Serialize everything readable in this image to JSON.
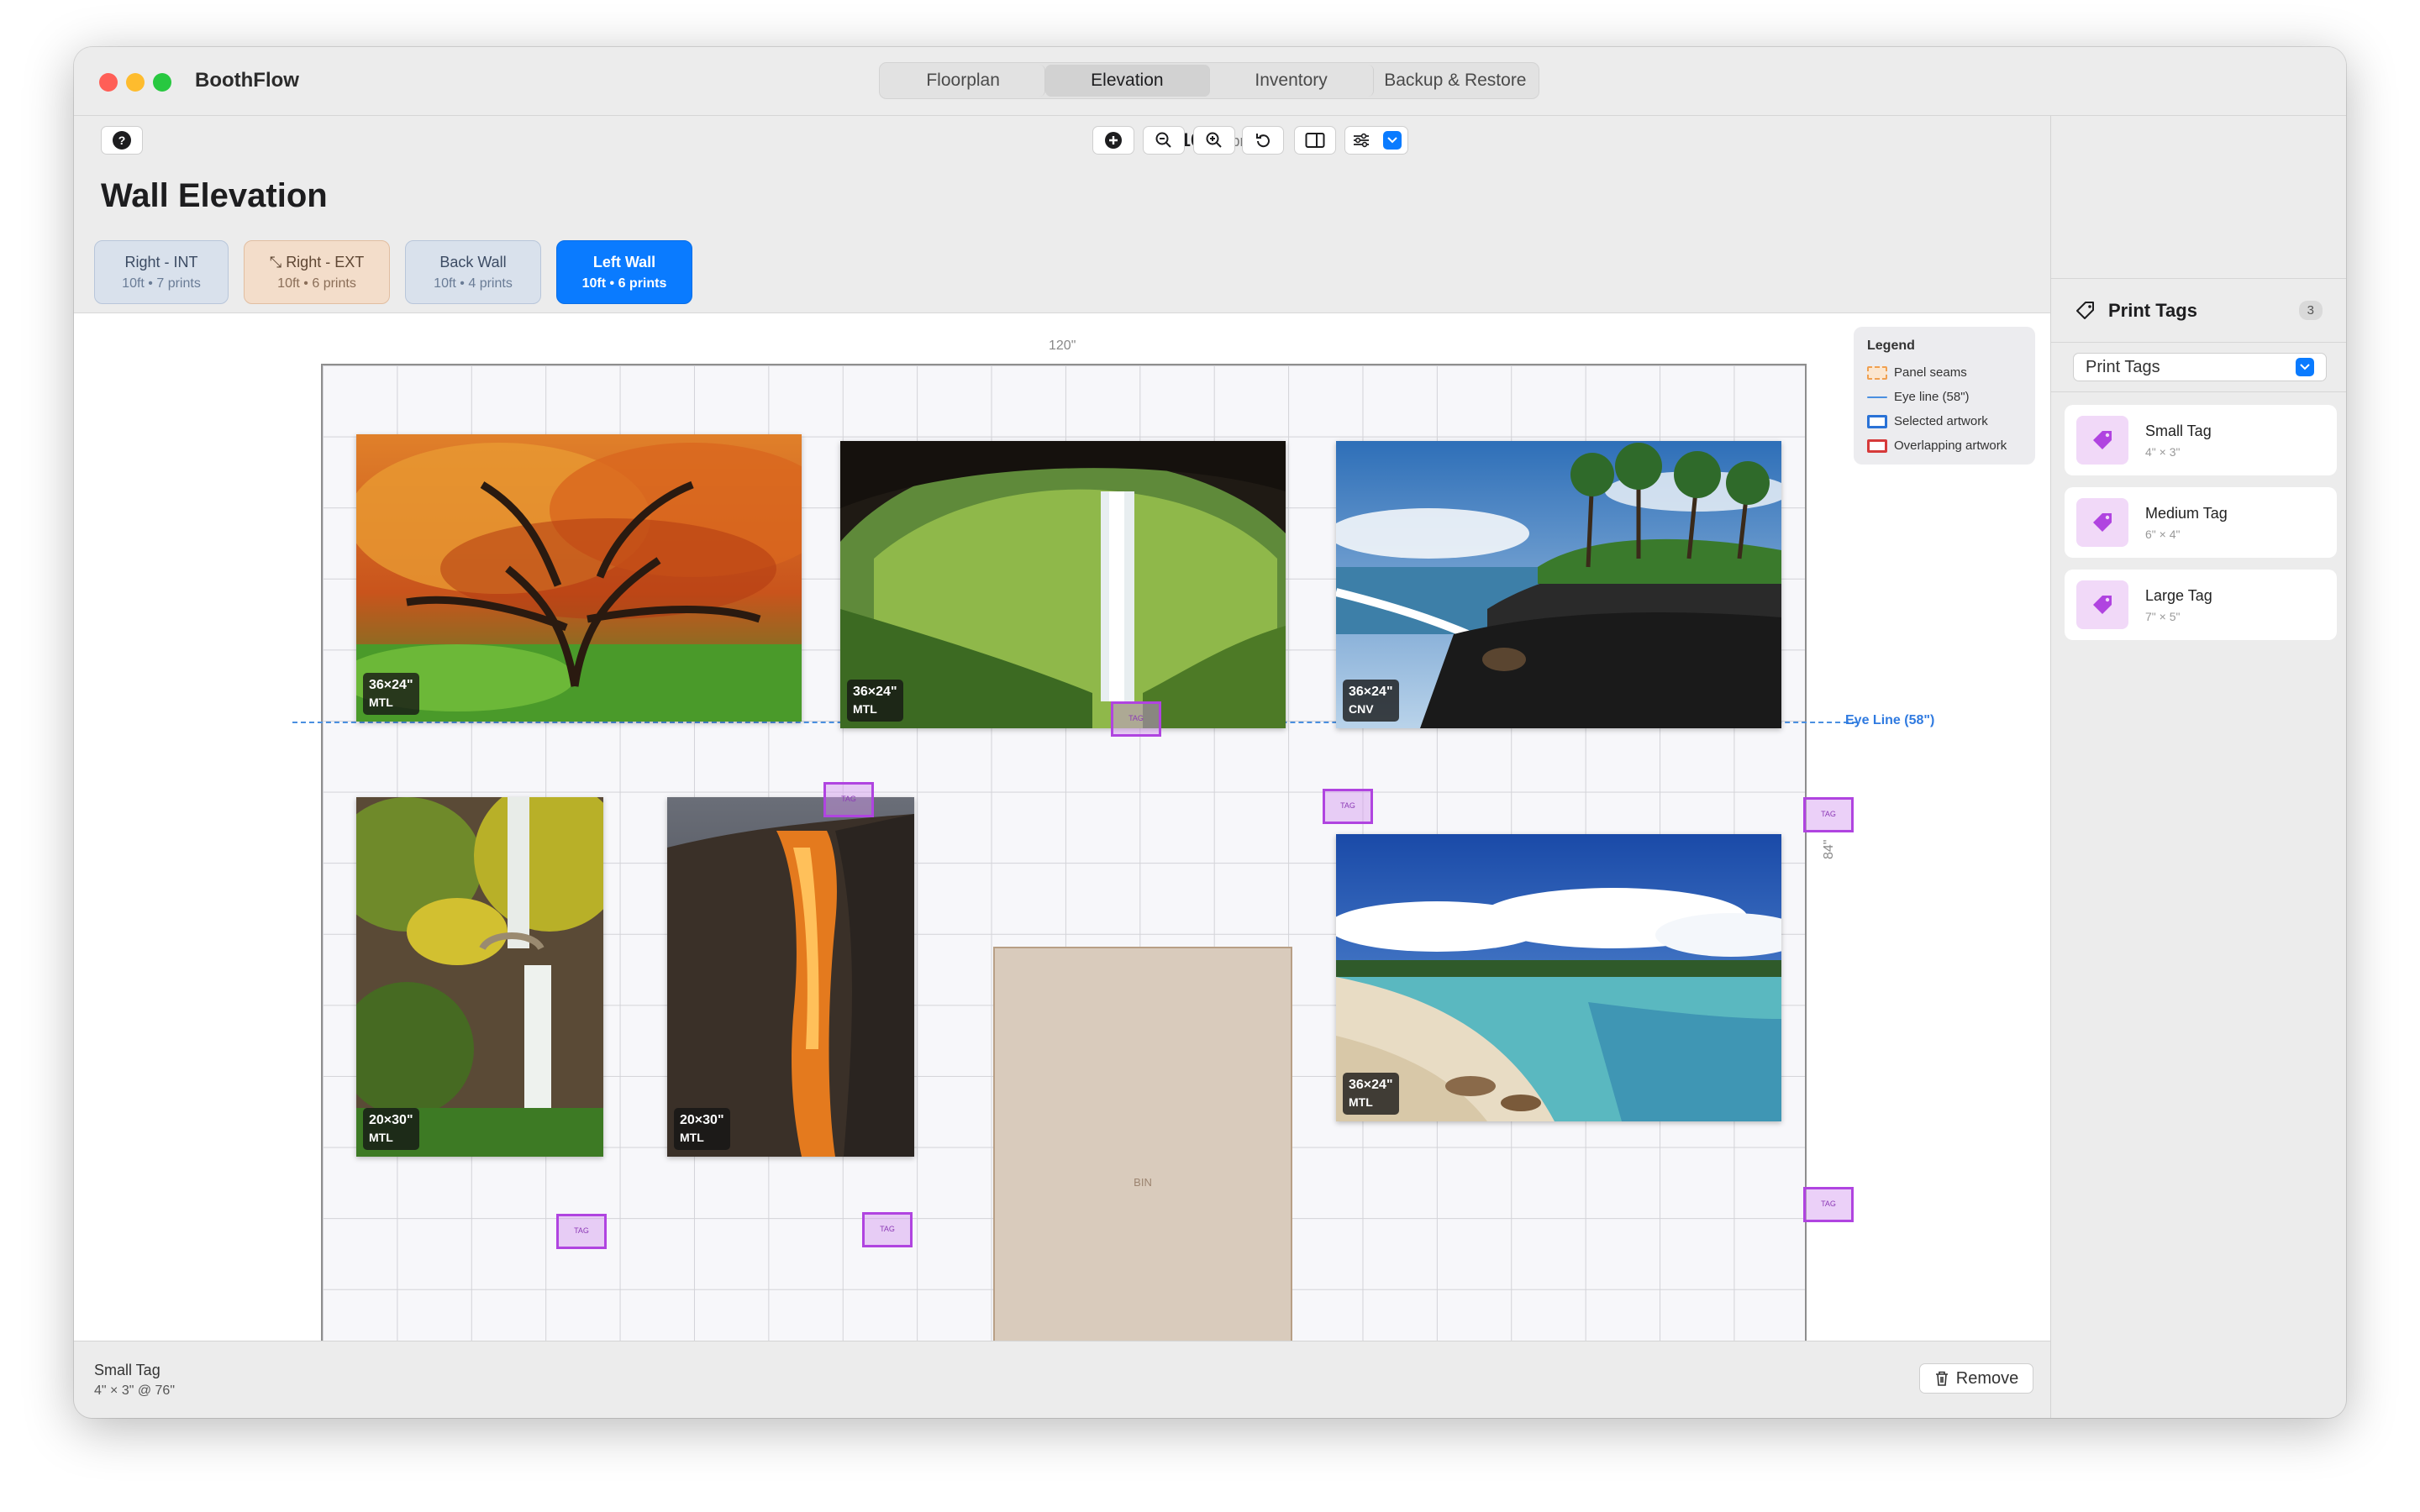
{
  "app": {
    "title": "BoothFlow"
  },
  "nav_tabs": [
    {
      "label": "Floorplan"
    },
    {
      "label": "Elevation"
    },
    {
      "label": "Inventory"
    },
    {
      "label": "Backup & Restore"
    }
  ],
  "toolbar": {
    "booth": "10x10",
    "prints": "• 6 prints"
  },
  "page": {
    "title": "Wall Elevation"
  },
  "walls": [
    {
      "label": "Right - INT",
      "sub": "10ft • 7 prints"
    },
    {
      "label": "Right - EXT",
      "sub": "10ft • 6 prints"
    },
    {
      "label": "Back Wall",
      "sub": "10ft • 4 prints"
    },
    {
      "label": "Left Wall",
      "sub": "10ft • 6 prints"
    }
  ],
  "canvas": {
    "width_label": "120\"",
    "height_label": "84\"",
    "eye_line_label": "Eye Line (58\")",
    "bin_label": "BIN",
    "tag_text": "TAG"
  },
  "legend": {
    "title": "Legend",
    "items": [
      "Panel seams",
      "Eye line (58\")",
      "Selected artwork",
      "Overlapping artwork"
    ],
    "colors": [
      "#f0a050",
      "#4a8fe0",
      "#2a72d6",
      "#d63a3a"
    ]
  },
  "artworks": [
    {
      "size": "36×24\"",
      "material": "MTL"
    },
    {
      "size": "36×24\"",
      "material": "MTL"
    },
    {
      "size": "36×24\"",
      "material": "CNV"
    },
    {
      "size": "20×30\"",
      "material": "MTL"
    },
    {
      "size": "20×30\"",
      "material": "MTL"
    },
    {
      "size": "36×24\"",
      "material": "MTL"
    }
  ],
  "side_panel": {
    "title": "Print Tags",
    "count": "3",
    "select_value": "Print Tags",
    "tags": [
      {
        "name": "Small Tag",
        "dims": "4\" × 3\""
      },
      {
        "name": "Medium Tag",
        "dims": "6\" × 4\""
      },
      {
        "name": "Large Tag",
        "dims": "7\" × 5\""
      }
    ]
  },
  "status": {
    "selected_name": "Small Tag",
    "selected_meta": "4\" × 3\" @ 76\"",
    "remove_label": "Remove"
  },
  "colors": {
    "accent": "#0a7bff",
    "tag": "#b044e0"
  }
}
